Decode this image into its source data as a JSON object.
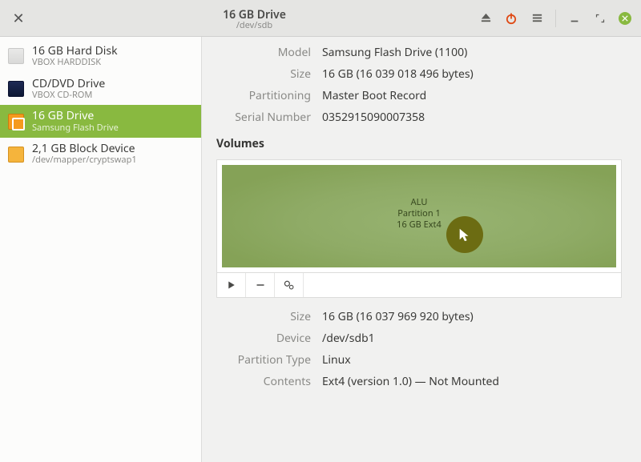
{
  "header": {
    "title": "16 GB Drive",
    "subtitle": "/dev/sdb"
  },
  "sidebar": {
    "items": [
      {
        "name": "16 GB Hard Disk",
        "detail": "VBOX HARDDISK",
        "icon": "hdd",
        "selected": false
      },
      {
        "name": "CD/DVD Drive",
        "detail": "VBOX CD-ROM",
        "icon": "cd",
        "selected": false
      },
      {
        "name": "16 GB Drive",
        "detail": "Samsung Flash Drive",
        "icon": "usb",
        "selected": true
      },
      {
        "name": "2,1 GB Block Device",
        "detail": "/dev/mapper/cryptswap1",
        "icon": "blk",
        "selected": false
      }
    ]
  },
  "drive": {
    "labels": {
      "model": "Model",
      "size": "Size",
      "partitioning": "Partitioning",
      "serial": "Serial Number"
    },
    "model": "Samsung Flash Drive (1100)",
    "size": "16 GB (16 039 018 496 bytes)",
    "partitioning": "Master Boot Record",
    "serial": "0352915090007358"
  },
  "volumes": {
    "heading": "Volumes",
    "partition": {
      "label1": "ALU",
      "label2": "Partition 1",
      "label3": "16 GB Ext4"
    },
    "detail_labels": {
      "size": "Size",
      "device": "Device",
      "ptype": "Partition Type",
      "contents": "Contents"
    },
    "details": {
      "size": "16 GB (16 037 969 920 bytes)",
      "device": "/dev/sdb1",
      "ptype": "Linux",
      "contents": "Ext4 (version 1.0) — Not Mounted"
    }
  }
}
